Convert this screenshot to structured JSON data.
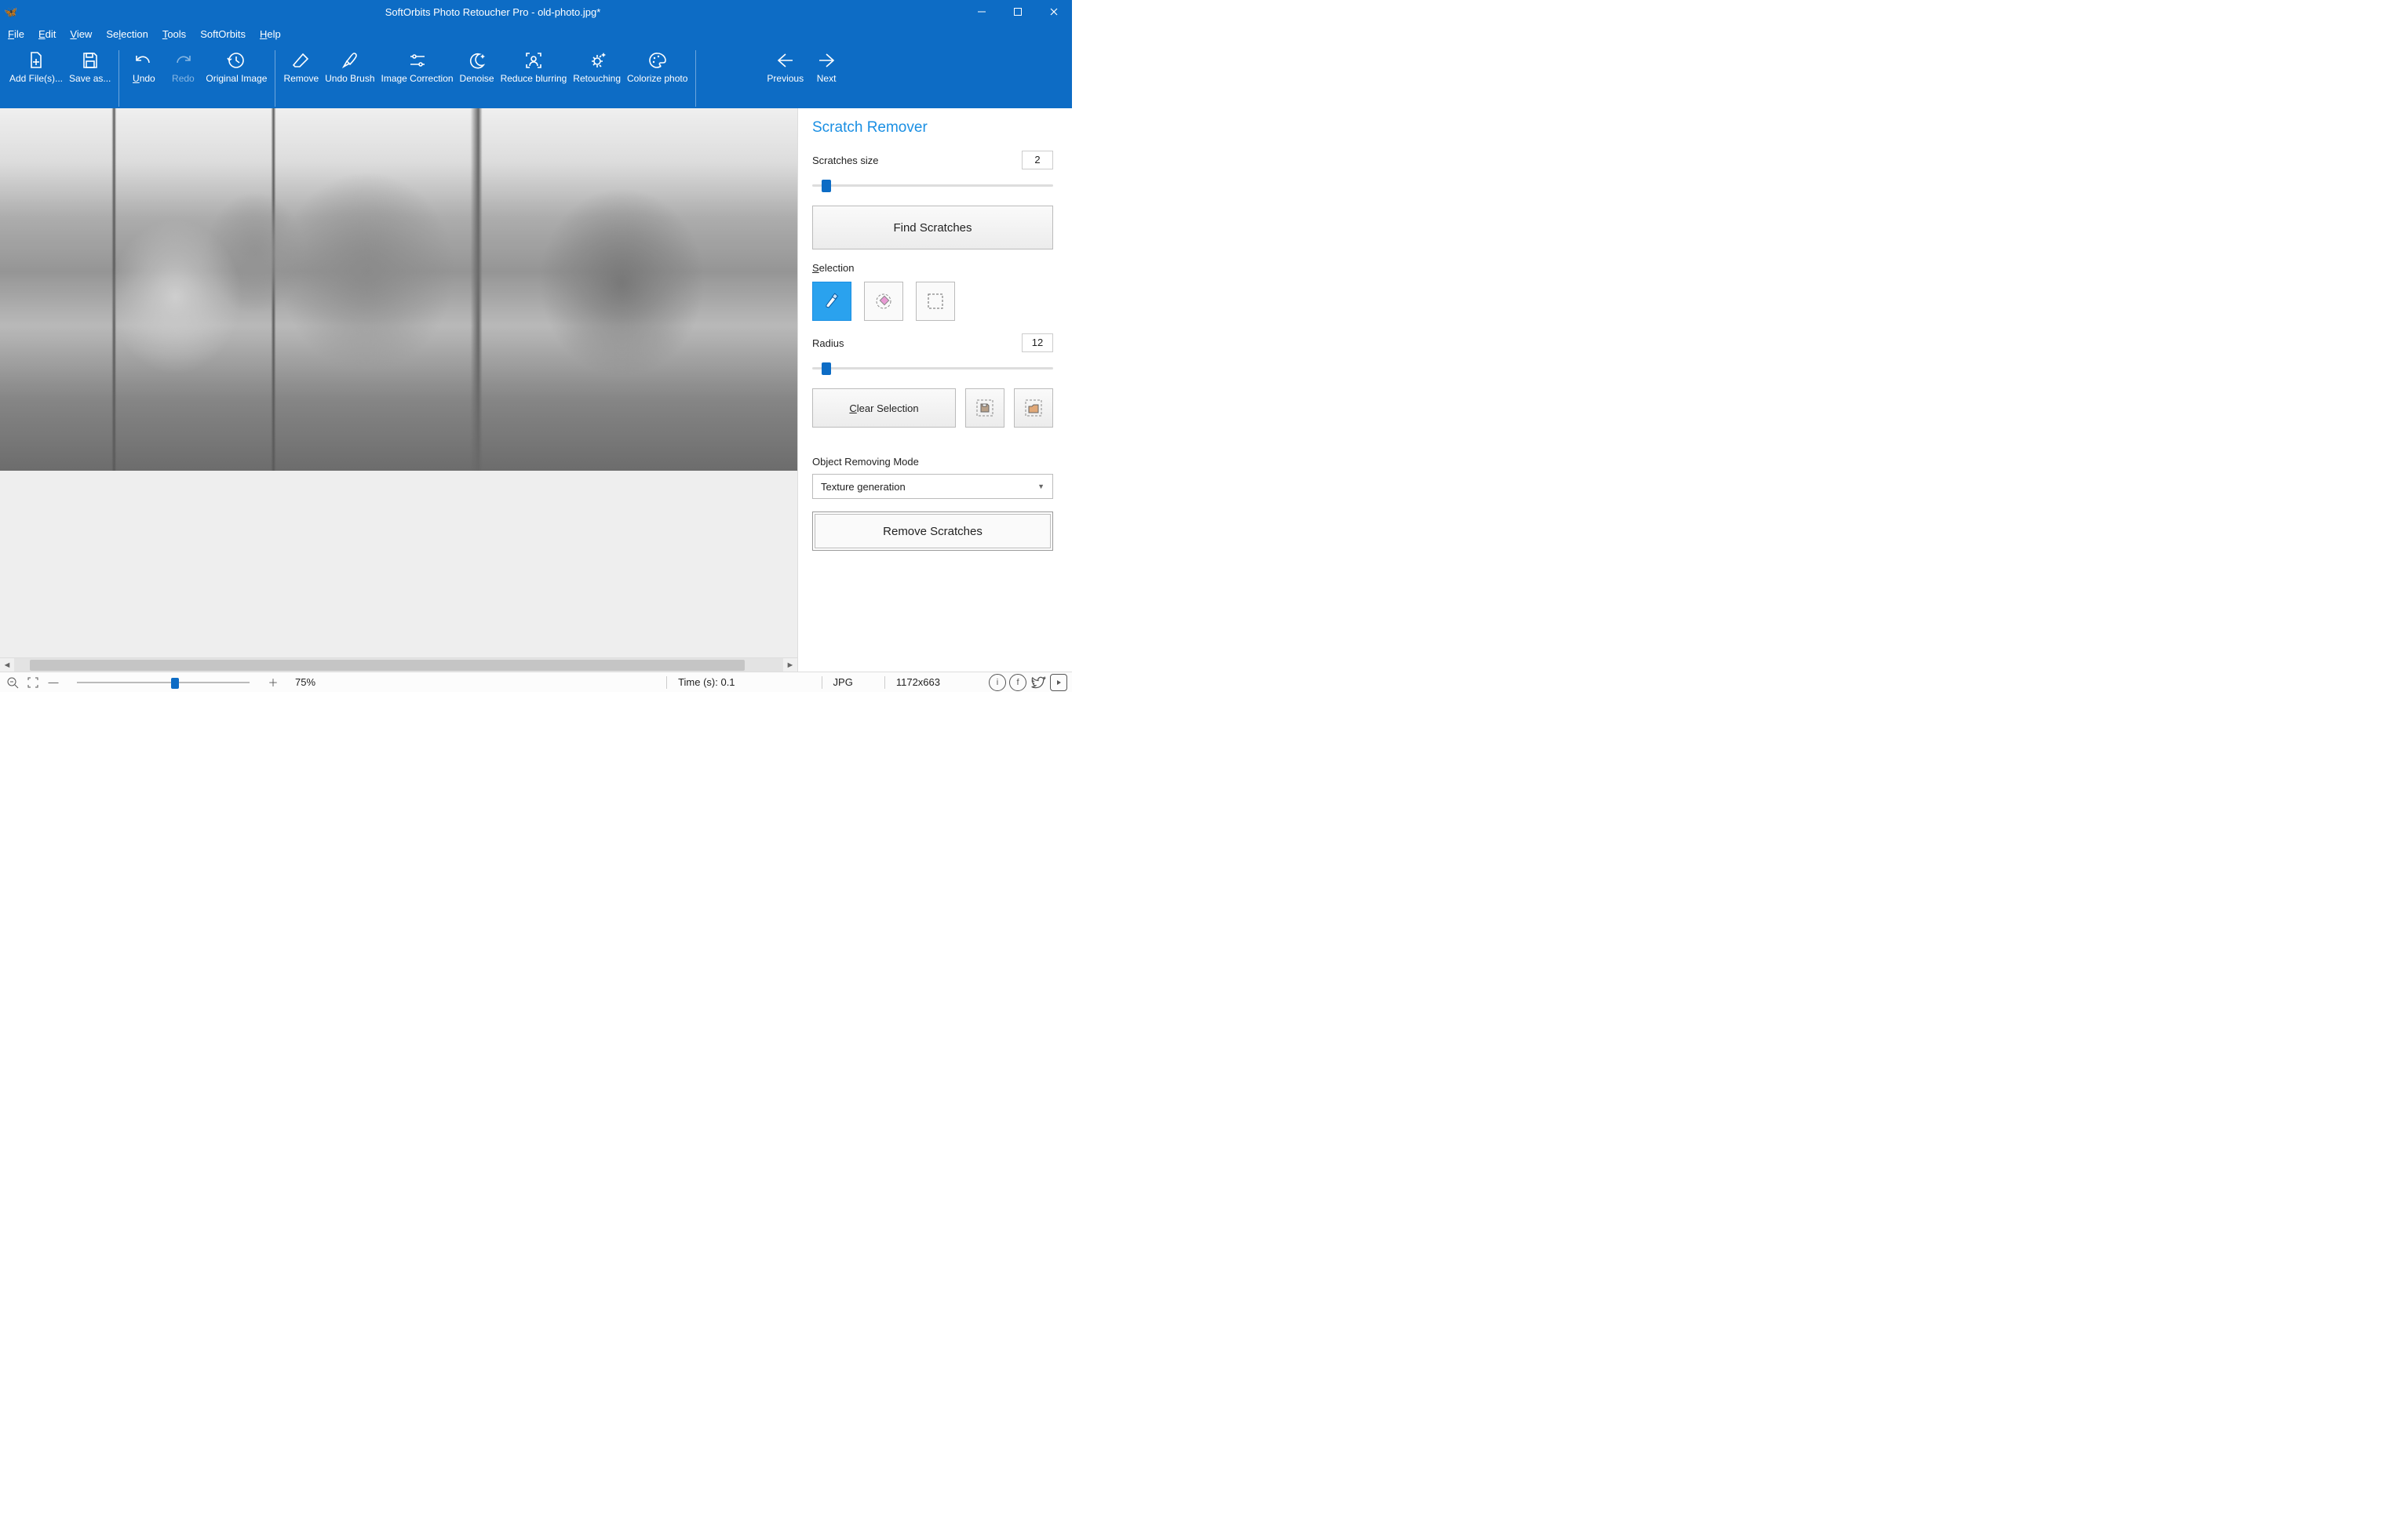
{
  "window": {
    "title": "SoftOrbits Photo Retoucher Pro - old-photo.jpg*"
  },
  "menu": [
    "File",
    "Edit",
    "View",
    "Selection",
    "Tools",
    "SoftOrbits",
    "Help"
  ],
  "toolbar": {
    "add": "Add File(s)...",
    "save": "Save as...",
    "undo": "Undo",
    "redo": "Redo",
    "original": "Original Image",
    "remove": "Remove",
    "undobrush": "Undo Brush",
    "imgcorr": "Image Correction",
    "denoise": "Denoise",
    "reduce": "Reduce blurring",
    "retouch": "Retouching",
    "colorize": "Colorize photo",
    "prev": "Previous",
    "next": "Next"
  },
  "panel": {
    "title": "Scratch Remover",
    "scratches_label": "Scratches size",
    "scratches_value": "2",
    "find_btn": "Find Scratches",
    "selection_label": "Selection",
    "radius_label": "Radius",
    "radius_value": "12",
    "clear_btn": "Clear Selection",
    "mode_label": "Object Removing Mode",
    "mode_value": "Texture generation",
    "remove_btn": "Remove Scratches"
  },
  "status": {
    "zoom": "75%",
    "time": "Time (s): 0.1",
    "format": "JPG",
    "dims": "1172x663"
  }
}
